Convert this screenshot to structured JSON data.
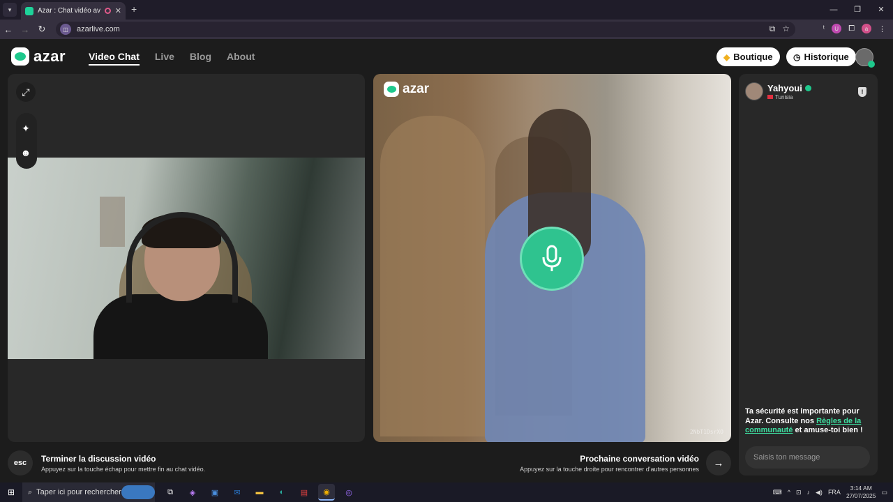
{
  "browser": {
    "tab_title": "Azar : Chat vidéo avec de n",
    "url": "azarlive.com",
    "window_controls": [
      "minimize-icon",
      "restore-icon",
      "close-icon"
    ]
  },
  "header": {
    "logo_text": "azar",
    "nav": [
      {
        "label": "Video Chat",
        "active": true
      },
      {
        "label": "Live",
        "active": false
      },
      {
        "label": "Blog",
        "active": false
      },
      {
        "label": "About",
        "active": false
      }
    ],
    "boutique_label": "Boutique",
    "historique_label": "Historique"
  },
  "partner": {
    "logo_text": "azar",
    "room_id": "2NbT1DsrXO",
    "mic_active": true
  },
  "chat": {
    "peer_name": "Yahyoui",
    "peer_country": "Tunisia",
    "safety_text_1": "Ta sécurité est importante pour Azar. Consulte nos ",
    "safety_link": "Règles de la communauté",
    "safety_text_2": " et amuse-toi bien !",
    "message_placeholder": "Saisis ton message"
  },
  "controls": {
    "end_key": "esc",
    "end_title": "Terminer la discussion vidéo",
    "end_hint": "Appuyez sur la touche échap pour mettre fin au chat vidéo.",
    "next_title": "Prochaine conversation vidéo",
    "next_hint": "Appuyez sur la touche droite pour rencontrer d'autres personnes"
  },
  "taskbar": {
    "search_placeholder": "Taper ici pour rechercher",
    "language": "FRA",
    "time": "3:14 AM",
    "date": "27/07/2025"
  },
  "colors": {
    "accent": "#1ec88c",
    "background": "#1c1c1c",
    "panel": "#282828"
  }
}
